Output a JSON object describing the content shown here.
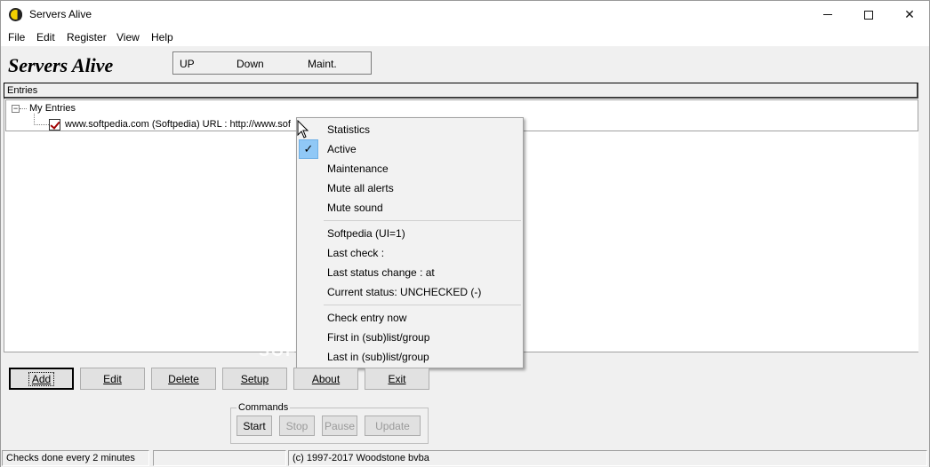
{
  "window": {
    "title": "Servers Alive",
    "controls": [
      "minimize",
      "maximize",
      "close"
    ]
  },
  "menubar": {
    "items": [
      "File",
      "Edit",
      "Register",
      "View",
      "Help"
    ]
  },
  "header": {
    "brand": "Servers Alive",
    "legend": [
      "UP",
      "Down",
      "Maint."
    ]
  },
  "entries": {
    "header": "Entries",
    "root_label": "My Entries",
    "root_expander": "−",
    "items": [
      {
        "label": "www.softpedia.com (Softpedia) URL : http://www.sof",
        "checked": true
      }
    ]
  },
  "context_menu": {
    "group1": [
      "Statistics",
      "Active",
      "Maintenance",
      "Mute all alerts",
      "Mute sound"
    ],
    "checked_item": "Active",
    "group2": [
      "Softpedia (UI=1)",
      "Last check :",
      "Last status change :  at",
      "Current status: UNCHECKED (-)"
    ],
    "group3": [
      "Check entry now",
      "First in (sub)list/group",
      "Last in (sub)list/group"
    ]
  },
  "buttons": {
    "add": "Add",
    "edit": "Edit",
    "delete": "Delete",
    "setup": "Setup",
    "about": "About",
    "exit": "Exit"
  },
  "commands": {
    "label": "Commands",
    "start": "Start",
    "stop": "Stop",
    "pause": "Pause",
    "update": "Update"
  },
  "statusbar": {
    "interval": "Checks done every  2 minutes",
    "middle": "",
    "copyright": "(c) 1997-2017 Woodstone bvba"
  },
  "watermark": "SOFTPEDIA"
}
